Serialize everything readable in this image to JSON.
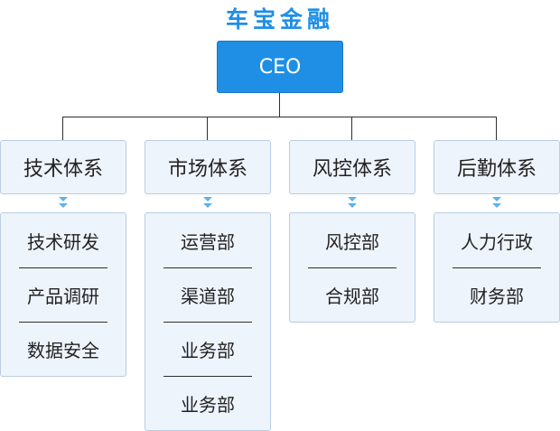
{
  "title": "车宝金融",
  "ceo": "CEO",
  "departments": [
    {
      "name": "技术体系",
      "units": [
        "技术研发",
        "产品调研",
        "数据安全"
      ]
    },
    {
      "name": "市场体系",
      "units": [
        "运营部",
        "渠道部",
        "业务部",
        "业务部"
      ]
    },
    {
      "name": "风控体系",
      "units": [
        "风控部",
        "合规部"
      ]
    },
    {
      "name": "后勤体系",
      "units": [
        "人力行政",
        "财务部"
      ]
    }
  ],
  "colors": {
    "accent": "#1f8fe5",
    "box_fill": "#eef4fc",
    "box_border": "#b9cde2",
    "arrow": "#5fb1ee"
  }
}
